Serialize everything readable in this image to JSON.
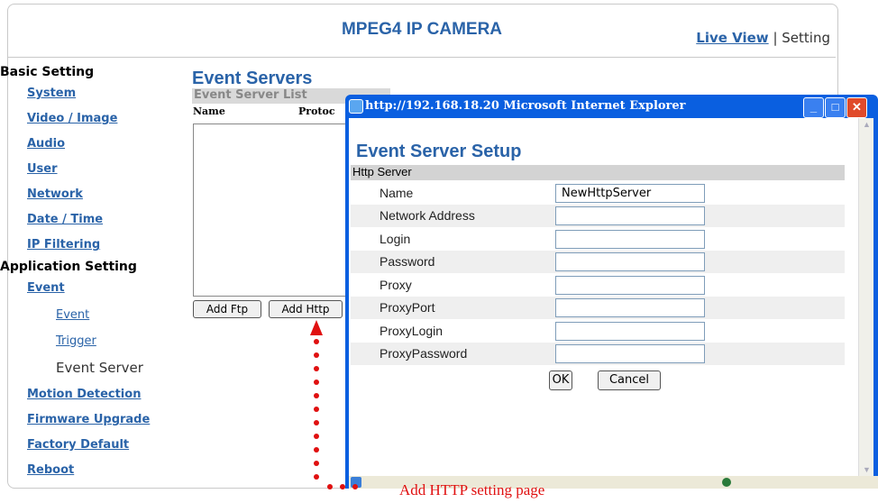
{
  "header": {
    "title": "MPEG4 IP CAMERA",
    "live_view": "Live View",
    "sep": "|",
    "setting": "Setting"
  },
  "sidebar": {
    "basic": "Basic Setting",
    "items": [
      "System",
      "Video / Image",
      "Audio",
      "User",
      "Network",
      "Date / Time",
      "IP Filtering"
    ],
    "app": "Application Setting",
    "event": "Event",
    "sub_event": "Event",
    "sub_trigger": "Trigger",
    "sub_current": "Event Server",
    "items2": [
      "Motion Detection",
      "Firmware Upgrade",
      "Factory Default",
      "Reboot"
    ]
  },
  "main": {
    "heading": "Event Servers",
    "list_title": "Event Server List",
    "col_name": "Name",
    "col_proto": "Protoc",
    "add_ftp": "Add Ftp",
    "add_http": "Add Http"
  },
  "popup": {
    "title": "http://192.168.18.20  Microsoft Internet Explorer",
    "heading": "Event Server Setup",
    "section": "Http Server",
    "fields": [
      {
        "label": "Name",
        "value": "NewHttpServer"
      },
      {
        "label": "Network Address",
        "value": ""
      },
      {
        "label": "Login",
        "value": ""
      },
      {
        "label": "Password",
        "value": ""
      },
      {
        "label": "Proxy",
        "value": ""
      },
      {
        "label": "ProxyPort",
        "value": ""
      },
      {
        "label": "ProxyLogin",
        "value": ""
      },
      {
        "label": "ProxyPassword",
        "value": ""
      }
    ],
    "ok": "OK",
    "cancel": "Cancel"
  },
  "annotation": "Add HTTP setting page",
  "colors": {
    "accent": "#2a63a8",
    "titlebar": "#0a5fe0",
    "close": "#e04a2a",
    "annotation": "#e01010"
  }
}
